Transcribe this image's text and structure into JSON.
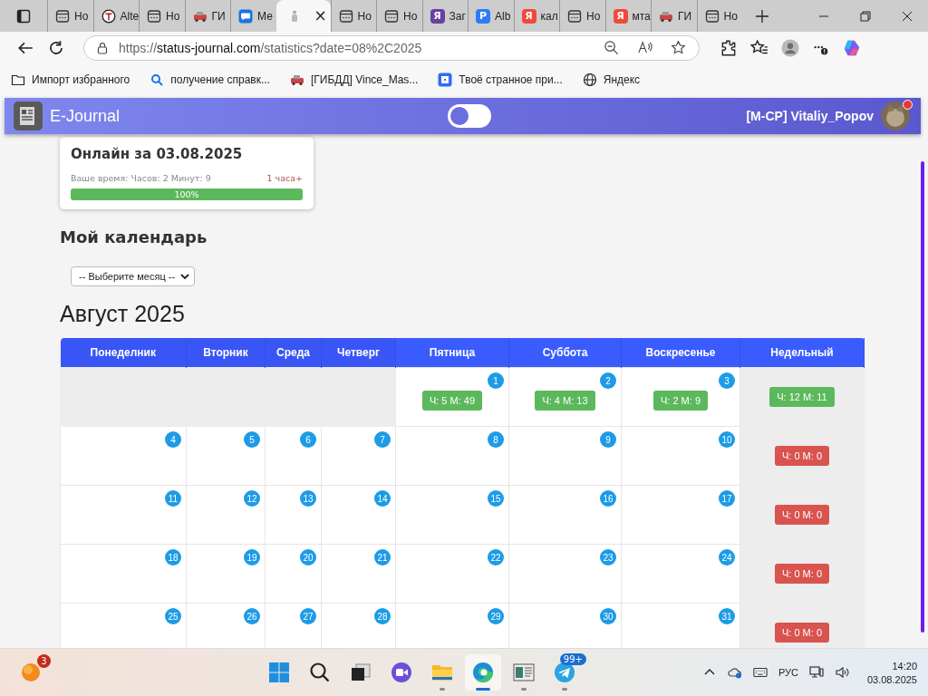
{
  "browser": {
    "tabs": [
      {
        "label": "Но",
        "kind": "page",
        "selected": false
      },
      {
        "label": "Alte",
        "kind": "ring",
        "selected": false
      },
      {
        "label": "Но",
        "kind": "page",
        "selected": false
      },
      {
        "label": "ГИ",
        "kind": "car",
        "selected": false
      },
      {
        "label": "Ме",
        "kind": "chat",
        "selected": false
      },
      {
        "kind": "figure",
        "close": "×",
        "selected": true
      },
      {
        "label": "Но",
        "kind": "page",
        "selected": false
      },
      {
        "label": "Но",
        "kind": "page",
        "selected": false
      },
      {
        "label": "Заг",
        "kind": "letter",
        "icon_text": "Я",
        "color": "#6b3fa0",
        "selected": false
      },
      {
        "label": "Alb",
        "kind": "letter",
        "icon_text": "P",
        "color": "#2f7cf6",
        "selected": false
      },
      {
        "label": "кал",
        "kind": "letter",
        "icon_text": "Я",
        "color": "#f0493a",
        "selected": false
      },
      {
        "label": "Но",
        "kind": "page",
        "selected": false
      },
      {
        "label": "мта",
        "kind": "letter",
        "icon_text": "Я",
        "color": "#f0493a",
        "selected": false
      },
      {
        "label": "ГИ",
        "kind": "car",
        "selected": false
      },
      {
        "label": "Но",
        "kind": "page",
        "selected": false
      }
    ],
    "url": {
      "scheme": "https://",
      "host": "status-journal.com",
      "path": "/statistics?date=08%2C2025"
    },
    "bookmarks": [
      {
        "label": "Импорт избранного",
        "kind": "folder"
      },
      {
        "label": "получение справк...",
        "kind": "search"
      },
      {
        "label": "[ГИБДД] Vince_Mas...",
        "kind": "car"
      },
      {
        "label": "Твоё странное при...",
        "kind": "app"
      },
      {
        "label": "Яндекс",
        "kind": "globe"
      }
    ]
  },
  "header": {
    "brand": "E-Journal",
    "toggle": {
      "on": false
    },
    "user": "[M-CP] Vitaliy_Popov",
    "notification": true
  },
  "online_card": {
    "title": "Онлайн за 03.08.2025",
    "time": "Ваше время: Часов: 2 Минут: 9",
    "goal": "1 часа+",
    "progress": {
      "level": 1,
      "text": "100%"
    }
  },
  "calendar": {
    "heading": "Мой календарь",
    "month_select": {
      "value": "-- Выберите месяц --"
    },
    "month_title": "Август 2025",
    "columns": [
      {
        "label": "Понеделник"
      },
      {
        "label": "Вторник"
      },
      {
        "label": "Среда"
      },
      {
        "label": "Четверг"
      },
      {
        "label": "Пятница"
      },
      {
        "label": "Суббота"
      },
      {
        "label": "Воскресенье"
      },
      {
        "label": "Недельный"
      }
    ],
    "weeks": [
      {
        "days": [
          {
            "kind": "blank"
          },
          {
            "kind": "blank"
          },
          {
            "kind": "blank"
          },
          {
            "kind": "blank"
          },
          {
            "kind": "day",
            "number": "1",
            "entry": {
              "text": "Ч: 5 М: 49",
              "color": "#5cb85c"
            }
          },
          {
            "kind": "day",
            "number": "2",
            "entry": {
              "text": "Ч: 4 М: 13",
              "color": "#5cb85c"
            }
          },
          {
            "kind": "day",
            "number": "3",
            "entry": {
              "text": "Ч: 2 М: 9",
              "color": "#5cb85c"
            }
          }
        ],
        "weekly": {
          "text": "Ч: 12 М: 11",
          "color": "#5cb85c"
        }
      },
      {
        "days": [
          {
            "kind": "day",
            "number": "4"
          },
          {
            "kind": "day",
            "number": "5"
          },
          {
            "kind": "day",
            "number": "6"
          },
          {
            "kind": "day",
            "number": "7"
          },
          {
            "kind": "day",
            "number": "8"
          },
          {
            "kind": "day",
            "number": "9"
          },
          {
            "kind": "day",
            "number": "10"
          }
        ],
        "weekly": {
          "text": "Ч: 0 М: 0",
          "color": "#d9534f"
        }
      },
      {
        "days": [
          {
            "kind": "day",
            "number": "11"
          },
          {
            "kind": "day",
            "number": "12"
          },
          {
            "kind": "day",
            "number": "13"
          },
          {
            "kind": "day",
            "number": "14"
          },
          {
            "kind": "day",
            "number": "15"
          },
          {
            "kind": "day",
            "number": "16"
          },
          {
            "kind": "day",
            "number": "17"
          }
        ],
        "weekly": {
          "text": "Ч: 0 М: 0",
          "color": "#d9534f"
        }
      },
      {
        "days": [
          {
            "kind": "day",
            "number": "18"
          },
          {
            "kind": "day",
            "number": "19"
          },
          {
            "kind": "day",
            "number": "20"
          },
          {
            "kind": "day",
            "number": "21"
          },
          {
            "kind": "day",
            "number": "22"
          },
          {
            "kind": "day",
            "number": "23"
          },
          {
            "kind": "day",
            "number": "24"
          }
        ],
        "weekly": {
          "text": "Ч: 0 М: 0",
          "color": "#d9534f"
        }
      },
      {
        "days": [
          {
            "kind": "day",
            "number": "25"
          },
          {
            "kind": "day",
            "number": "26"
          },
          {
            "kind": "day",
            "number": "27"
          },
          {
            "kind": "day",
            "number": "28"
          },
          {
            "kind": "day",
            "number": "29"
          },
          {
            "kind": "day",
            "number": "30"
          },
          {
            "kind": "day",
            "number": "31"
          }
        ],
        "weekly": {
          "text": "Ч: 0 М: 0",
          "color": "#d9534f"
        }
      }
    ]
  },
  "taskbar": {
    "weather_badge": "3",
    "apps": [
      {
        "kind": "start",
        "running": false
      },
      {
        "kind": "search",
        "running": false
      },
      {
        "kind": "windows",
        "running": false
      },
      {
        "kind": "video",
        "running": false
      },
      {
        "kind": "folder",
        "running": true
      },
      {
        "kind": "edge",
        "running": true,
        "selected": true
      },
      {
        "kind": "reader",
        "running": true
      },
      {
        "kind": "telegram",
        "running": true,
        "badge": "99+"
      }
    ],
    "language": "РУС",
    "time": "14:20",
    "date": "03.08.2025"
  }
}
